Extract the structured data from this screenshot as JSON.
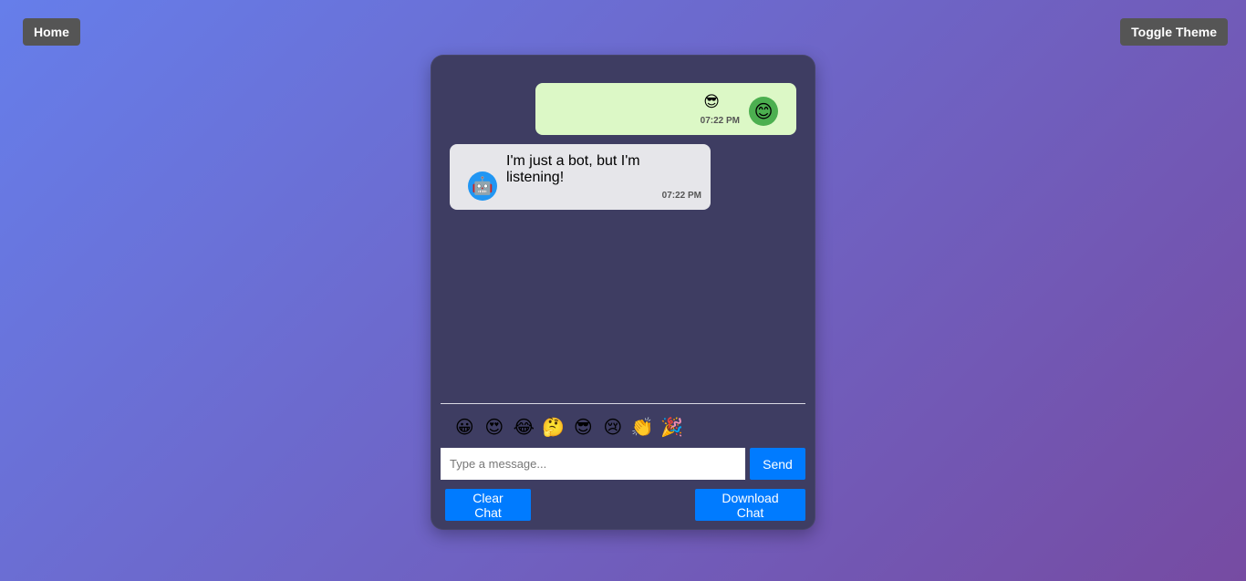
{
  "nav": {
    "home_label": "Home",
    "theme_label": "Toggle Theme"
  },
  "messages": [
    {
      "sender": "user",
      "text": "😎",
      "time": "07:22 PM",
      "avatar": "😊"
    },
    {
      "sender": "bot",
      "text": "I'm just a bot, but I'm listening!",
      "time": "07:22 PM",
      "avatar": "🤖"
    }
  ],
  "emojis": [
    "😀",
    "😍",
    "😂",
    "🤔",
    "😎",
    "😢",
    "👏",
    "🎉"
  ],
  "input": {
    "placeholder": "Type a message...",
    "value": ""
  },
  "buttons": {
    "send": "Send",
    "clear": "Clear Chat",
    "download": "Download Chat"
  },
  "colors": {
    "background_start": "#667eea",
    "background_end": "#764ba2",
    "chat_bg": "#3e3d62",
    "user_bubble": "#dcf8c6",
    "bot_bubble": "#e6e6ea",
    "accent": "#007bff",
    "nav_button": "#555555",
    "user_avatar": "#4caf50",
    "bot_avatar": "#2196f3"
  }
}
